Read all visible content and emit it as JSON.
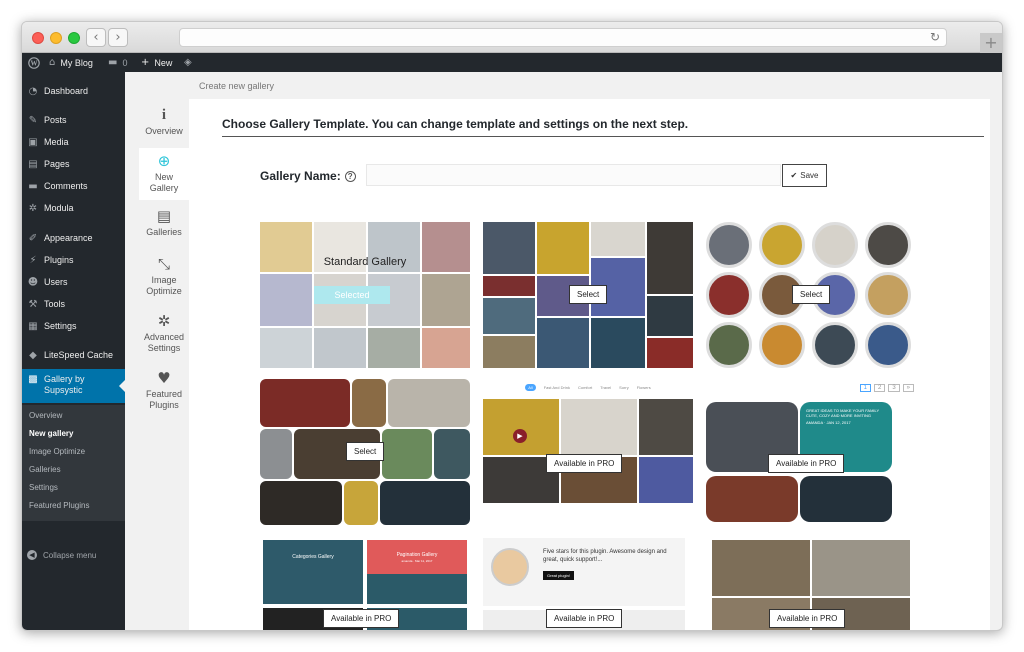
{
  "browser": {
    "back_icon": "‹",
    "forward_icon": "›",
    "reload_icon": "↻",
    "new_tab_icon": "+"
  },
  "adminbar": {
    "site_name": "My Blog",
    "comments_count": "0",
    "new_label": "New"
  },
  "sidebar": {
    "items": [
      {
        "label": "Dashboard",
        "icon": "dashboard-icon"
      },
      {
        "label": "Posts",
        "icon": "pin-icon"
      },
      {
        "label": "Media",
        "icon": "media-icon"
      },
      {
        "label": "Pages",
        "icon": "page-icon"
      },
      {
        "label": "Comments",
        "icon": "comment-icon"
      },
      {
        "label": "Modula",
        "icon": "gear-icon"
      },
      {
        "label": "Appearance",
        "icon": "brush-icon"
      },
      {
        "label": "Plugins",
        "icon": "plug-icon"
      },
      {
        "label": "Users",
        "icon": "user-icon"
      },
      {
        "label": "Tools",
        "icon": "wrench-icon"
      },
      {
        "label": "Settings",
        "icon": "settings-icon"
      },
      {
        "label": "LiteSpeed Cache",
        "icon": "diamond-icon"
      },
      {
        "label": "Gallery by Supsystic",
        "icon": "gallery-icon"
      }
    ],
    "submenu": [
      "Overview",
      "New gallery",
      "Image Optimize",
      "Galleries",
      "Settings",
      "Featured Plugins"
    ],
    "collapse_label": "Collapse menu"
  },
  "tabs": [
    {
      "label": "Overview",
      "icon": "info-icon"
    },
    {
      "label": "New Gallery",
      "icon": "plus-circle-icon"
    },
    {
      "label": "Galleries",
      "icon": "archive-icon"
    },
    {
      "label": "Image Optimize",
      "icon": "compress-icon"
    },
    {
      "label": "Advanced Settings",
      "icon": "gear-icon"
    },
    {
      "label": "Featured Plugins",
      "icon": "heart-icon"
    }
  ],
  "breadcrumb": "Create new gallery",
  "main": {
    "heading": "Choose Gallery Template. You can change template and settings on the next step.",
    "gallery_name_label": "Gallery Name:",
    "gallery_name_value": "",
    "save_label": "Save"
  },
  "templates": [
    {
      "title": "Standard Gallery",
      "button": "Selected"
    },
    {
      "button": "Select"
    },
    {
      "button": "Select"
    },
    {
      "button": "Select"
    },
    {
      "button": "Available in PRO",
      "filters": [
        "All",
        "Fast And Drink",
        "Comfort",
        "Travel",
        "Sorry",
        "Flowers"
      ]
    },
    {
      "button": "Available in PRO",
      "pages": [
        "1",
        "2",
        "3",
        "»"
      ],
      "promo_lines": [
        "GREAT IDEAS TO MAKE YOUR FAMILY CUTE, COZY AND MORE INVITING",
        "AMANDA · JAN 12, 2017"
      ]
    },
    {
      "button": "Available in PRO",
      "labels": [
        "Categories Gallery",
        "Pagination Gallery",
        "amanda · Mar 11, 2017"
      ]
    },
    {
      "button": "Available in PRO",
      "review": "Five stars for this plugin. Awesome design and great, quick support!...",
      "review_button": "Great plugin!"
    },
    {
      "button": "Available in PRO"
    }
  ],
  "colors": {
    "admin_dark": "#23282d",
    "accent_blue": "#0073aa",
    "tab_teal": "#2bc4d8"
  }
}
